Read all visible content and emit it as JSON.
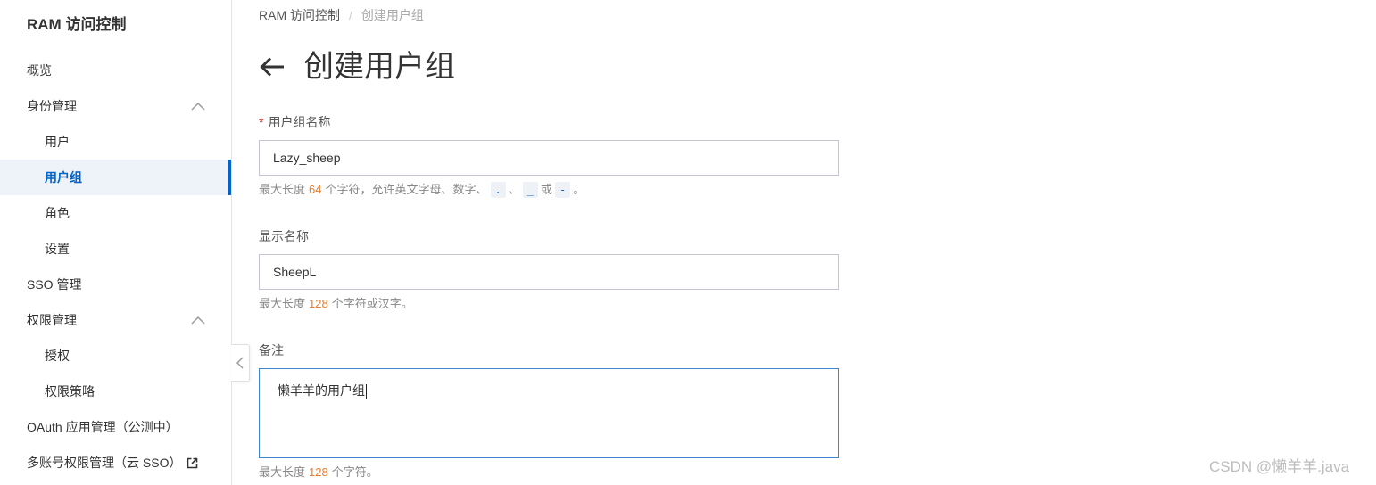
{
  "colors": {
    "accent": "#0064c8",
    "active_bg": "#eef3f9",
    "required_mark": "#d93026",
    "limit_number": "#e87b2e",
    "focus_border": "#3a86d0"
  },
  "sidebar": {
    "title": "RAM 访问控制",
    "collapse_icon": "chevron-left-icon",
    "items": [
      {
        "label": "概览"
      },
      {
        "label": "身份管理",
        "icon": "chevron-up-icon",
        "expanded": true,
        "children": [
          {
            "label": "用户"
          },
          {
            "label": "用户组",
            "active": true
          },
          {
            "label": "角色"
          },
          {
            "label": "设置"
          }
        ]
      },
      {
        "label": "SSO 管理"
      },
      {
        "label": "权限管理",
        "icon": "chevron-up-icon",
        "expanded": true,
        "children": [
          {
            "label": "授权"
          },
          {
            "label": "权限策略"
          }
        ]
      },
      {
        "label": "OAuth 应用管理（公测中）"
      },
      {
        "label": "多账号权限管理（云 SSO）",
        "icon": "external-link-icon"
      }
    ]
  },
  "breadcrumb": {
    "items": [
      "RAM 访问控制",
      "创建用户组"
    ],
    "separator": "/"
  },
  "header": {
    "back_icon": "arrow-left-icon",
    "title": "创建用户组"
  },
  "form": {
    "group_name": {
      "required_mark": "*",
      "label": "用户组名称",
      "value": "Lazy_sheep",
      "help": {
        "prefix": "最大长度",
        "limit": "64",
        "suffix": "个字符，允许英文字母、数字、",
        "char_dot": ".",
        "sep": "、",
        "char_underscore": "_",
        "or": "或",
        "char_dash": "-",
        "end": "。"
      }
    },
    "display_name": {
      "label": "显示名称",
      "value": "SheepL",
      "help": {
        "prefix": "最大长度",
        "limit": "128",
        "suffix": "个字符或汉字。"
      }
    },
    "remark": {
      "label": "备注",
      "value": "懒羊羊的用户组",
      "help": {
        "prefix": "最大长度",
        "limit": "128",
        "suffix": "个字符。"
      }
    }
  },
  "watermark": "CSDN @懒羊羊.java"
}
